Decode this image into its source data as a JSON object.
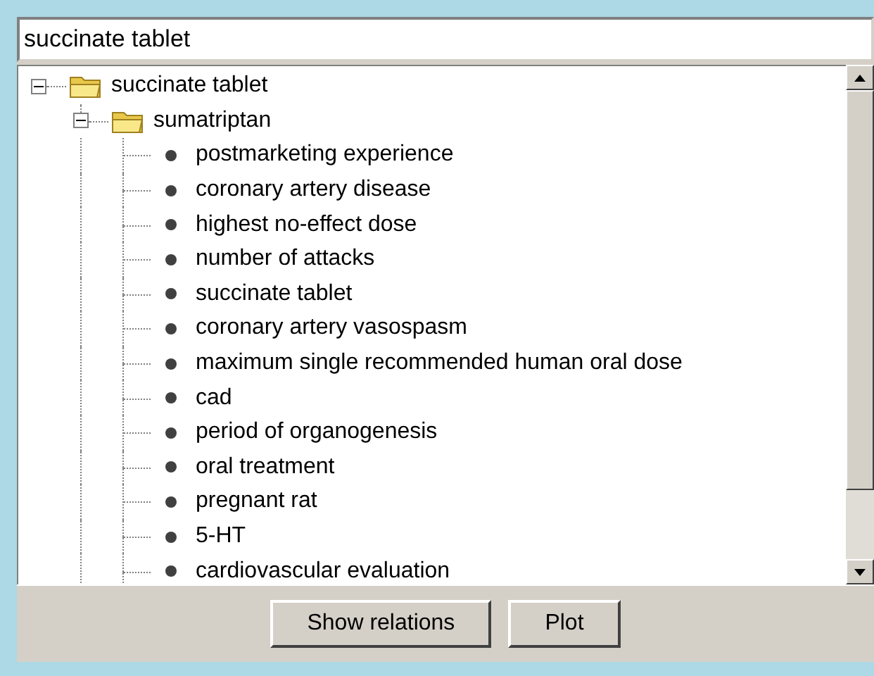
{
  "search_field": {
    "value": "succinate tablet"
  },
  "tree": [
    {
      "label": "succinate tablet",
      "expanded": true,
      "children": [
        {
          "label": "sumatriptan",
          "expanded": true,
          "children": [
            {
              "label": "postmarketing experience"
            },
            {
              "label": "coronary artery disease"
            },
            {
              "label": "highest no-effect dose"
            },
            {
              "label": "number of attacks"
            },
            {
              "label": "succinate tablet"
            },
            {
              "label": "coronary artery vasospasm"
            },
            {
              "label": "maximum single recommended human oral dose"
            },
            {
              "label": "cad"
            },
            {
              "label": "period of organogenesis"
            },
            {
              "label": "oral treatment"
            },
            {
              "label": "pregnant rat"
            },
            {
              "label": "5-HT"
            },
            {
              "label": "cardiovascular evaluation"
            }
          ]
        }
      ]
    }
  ],
  "buttons": [
    "Show relations",
    "Plot"
  ]
}
